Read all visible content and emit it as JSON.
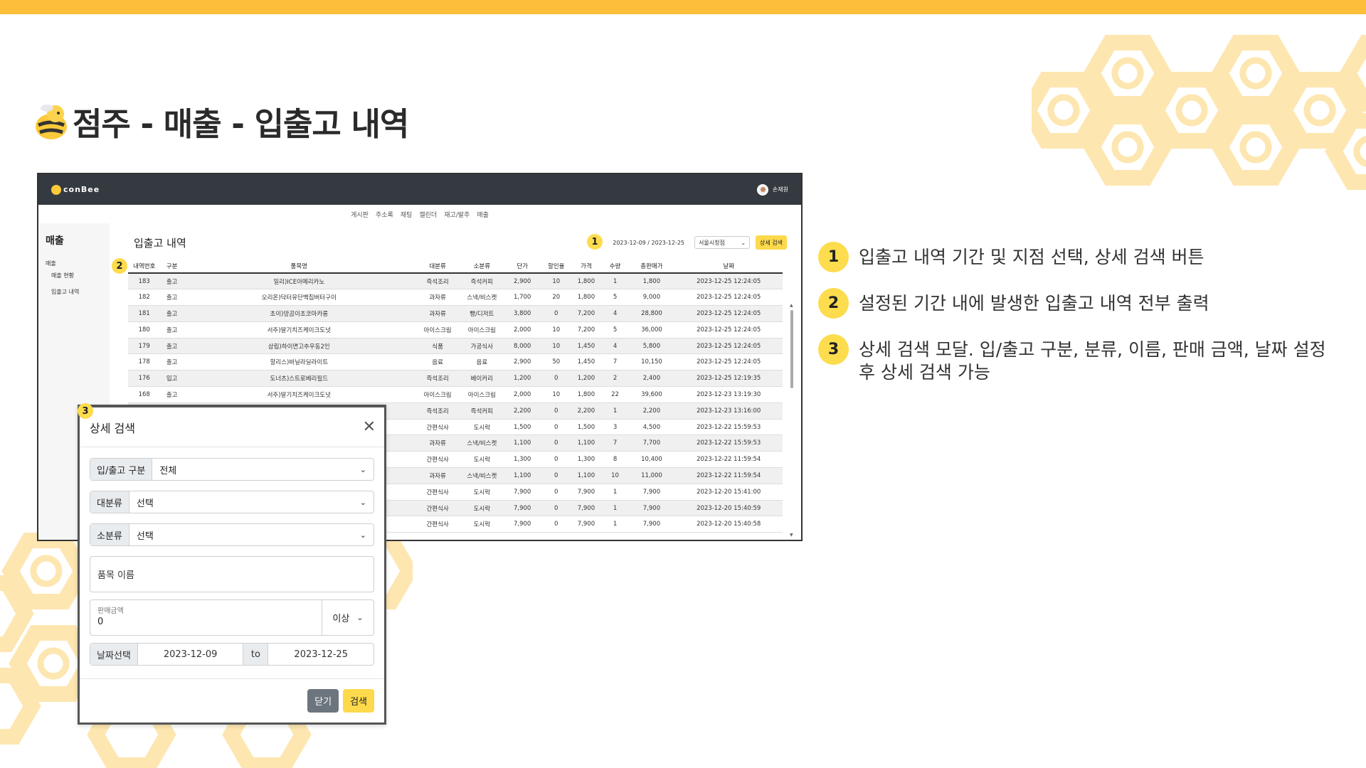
{
  "slide": {
    "title": "점주 - 매출 - 입출고 내역"
  },
  "app": {
    "brand": "conBee",
    "user_name": "손재원",
    "nav": [
      "게시판",
      "주소록",
      "채팅",
      "캘린더",
      "재고/발주",
      "매출"
    ],
    "sidebar": {
      "title": "매출",
      "group": "매출",
      "items": [
        "매출 현황",
        "입출고 내역"
      ]
    },
    "page_heading": "입출고 내역",
    "date_range": "2023-12-09 / 2023-12-25",
    "branch": "서울시청점",
    "detail_search_label": "상세 검색",
    "table": {
      "headers": [
        "내역번호",
        "구분",
        "품목명",
        "대분류",
        "소분류",
        "단가",
        "할인율",
        "가격",
        "수량",
        "총판매가",
        "날짜"
      ],
      "rows": [
        [
          "183",
          "출고",
          "일리)ICE아메리카노",
          "즉석조리",
          "즉석커피",
          "2,900",
          "10",
          "1,800",
          "1",
          "1,800",
          "2023-12-25 12:24:05"
        ],
        [
          "182",
          "출고",
          "오리온)닥터유단백칩버터구이",
          "과자류",
          "스낵/비스켓",
          "1,700",
          "20",
          "1,800",
          "5",
          "9,000",
          "2023-12-25 12:24:05"
        ],
        [
          "181",
          "출고",
          "초이)망곰이초코마카롱",
          "과자류",
          "빵/디저트",
          "3,800",
          "0",
          "7,200",
          "4",
          "28,800",
          "2023-12-25 12:24:05"
        ],
        [
          "180",
          "출고",
          "서주)딸기치즈케이크도넛",
          "아이스크림",
          "아이스크림",
          "2,000",
          "10",
          "7,200",
          "5",
          "36,000",
          "2023-12-25 12:24:05"
        ],
        [
          "179",
          "출고",
          "삼립)하이면고추우동2인",
          "식품",
          "가공식사",
          "8,000",
          "10",
          "1,450",
          "4",
          "5,800",
          "2023-12-25 12:24:05"
        ],
        [
          "178",
          "출고",
          "할리스)바닐라딜라이트",
          "음료",
          "음료",
          "2,900",
          "50",
          "1,450",
          "7",
          "10,150",
          "2023-12-25 12:24:05"
        ],
        [
          "176",
          "입고",
          "도너츠)스트로베리필드",
          "즉석조리",
          "베이커리",
          "1,200",
          "0",
          "1,200",
          "2",
          "2,400",
          "2023-12-25 12:19:35"
        ],
        [
          "168",
          "출고",
          "서주)딸기치즈케이크도넛",
          "아이스크림",
          "아이스크림",
          "2,000",
          "10",
          "1,800",
          "22",
          "39,600",
          "2023-12-23 13:19:30"
        ],
        [
          "",
          "",
          "",
          "즉석조리",
          "즉석커피",
          "2,200",
          "0",
          "2,200",
          "1",
          "2,200",
          "2023-12-23 13:16:00"
        ],
        [
          "",
          "",
          "",
          "간편식사",
          "도시락",
          "1,500",
          "0",
          "1,500",
          "3",
          "4,500",
          "2023-12-22 15:59:53"
        ],
        [
          "",
          "",
          "",
          "과자류",
          "스낵/비스켓",
          "1,100",
          "0",
          "1,100",
          "7",
          "7,700",
          "2023-12-22 15:59:53"
        ],
        [
          "",
          "",
          "",
          "간편식사",
          "도시락",
          "1,300",
          "0",
          "1,300",
          "8",
          "10,400",
          "2023-12-22 11:59:54"
        ],
        [
          "",
          "",
          "",
          "과자류",
          "스낵/비스켓",
          "1,100",
          "0",
          "1,100",
          "10",
          "11,000",
          "2023-12-22 11:59:54"
        ],
        [
          "",
          "",
          "",
          "간편식사",
          "도시락",
          "7,900",
          "0",
          "7,900",
          "1",
          "7,900",
          "2023-12-20 15:41:00"
        ],
        [
          "",
          "",
          "",
          "간편식사",
          "도시락",
          "7,900",
          "0",
          "7,900",
          "1",
          "7,900",
          "2023-12-20 15:40:59"
        ],
        [
          "",
          "",
          "",
          "간편식사",
          "도시락",
          "7,900",
          "0",
          "7,900",
          "1",
          "7,900",
          "2023-12-20 15:40:58"
        ]
      ]
    }
  },
  "modal": {
    "title": "상세 검색",
    "type_label": "입/출고 구분",
    "type_value": "전체",
    "major_label": "대분류",
    "major_value": "선택",
    "minor_label": "소분류",
    "minor_value": "선택",
    "name_placeholder": "품목 이름",
    "price_label": "판매금액",
    "price_value": "0",
    "price_condition": "이상",
    "date_label": "날짜선택",
    "date_from": "2023-12-09",
    "date_to_label": "to",
    "date_to": "2023-12-25",
    "close_label": "닫기",
    "search_label": "검색"
  },
  "badges": [
    "1",
    "2",
    "3"
  ],
  "notes": [
    {
      "num": "1",
      "text": "입출고 내역 기간 및 지점 선택, 상세 검색 버튼"
    },
    {
      "num": "2",
      "text": "설정된 기간 내에 발생한 입출고 내역 전부 출력"
    },
    {
      "num": "3",
      "text": "상세 검색 모달. 입/출고 구분, 분류, 이름, 판매 금액, 날짜 설정 후 상세 검색 가능"
    }
  ],
  "colors": {
    "accent": "#fdbf3a",
    "badge": "#fddc4d",
    "header_dark": "#343a40",
    "honeycomb": "#fde6b0"
  },
  "icons": [
    "bee-mascot-icon",
    "close-icon",
    "chevron-down-icon",
    "avatar"
  ]
}
